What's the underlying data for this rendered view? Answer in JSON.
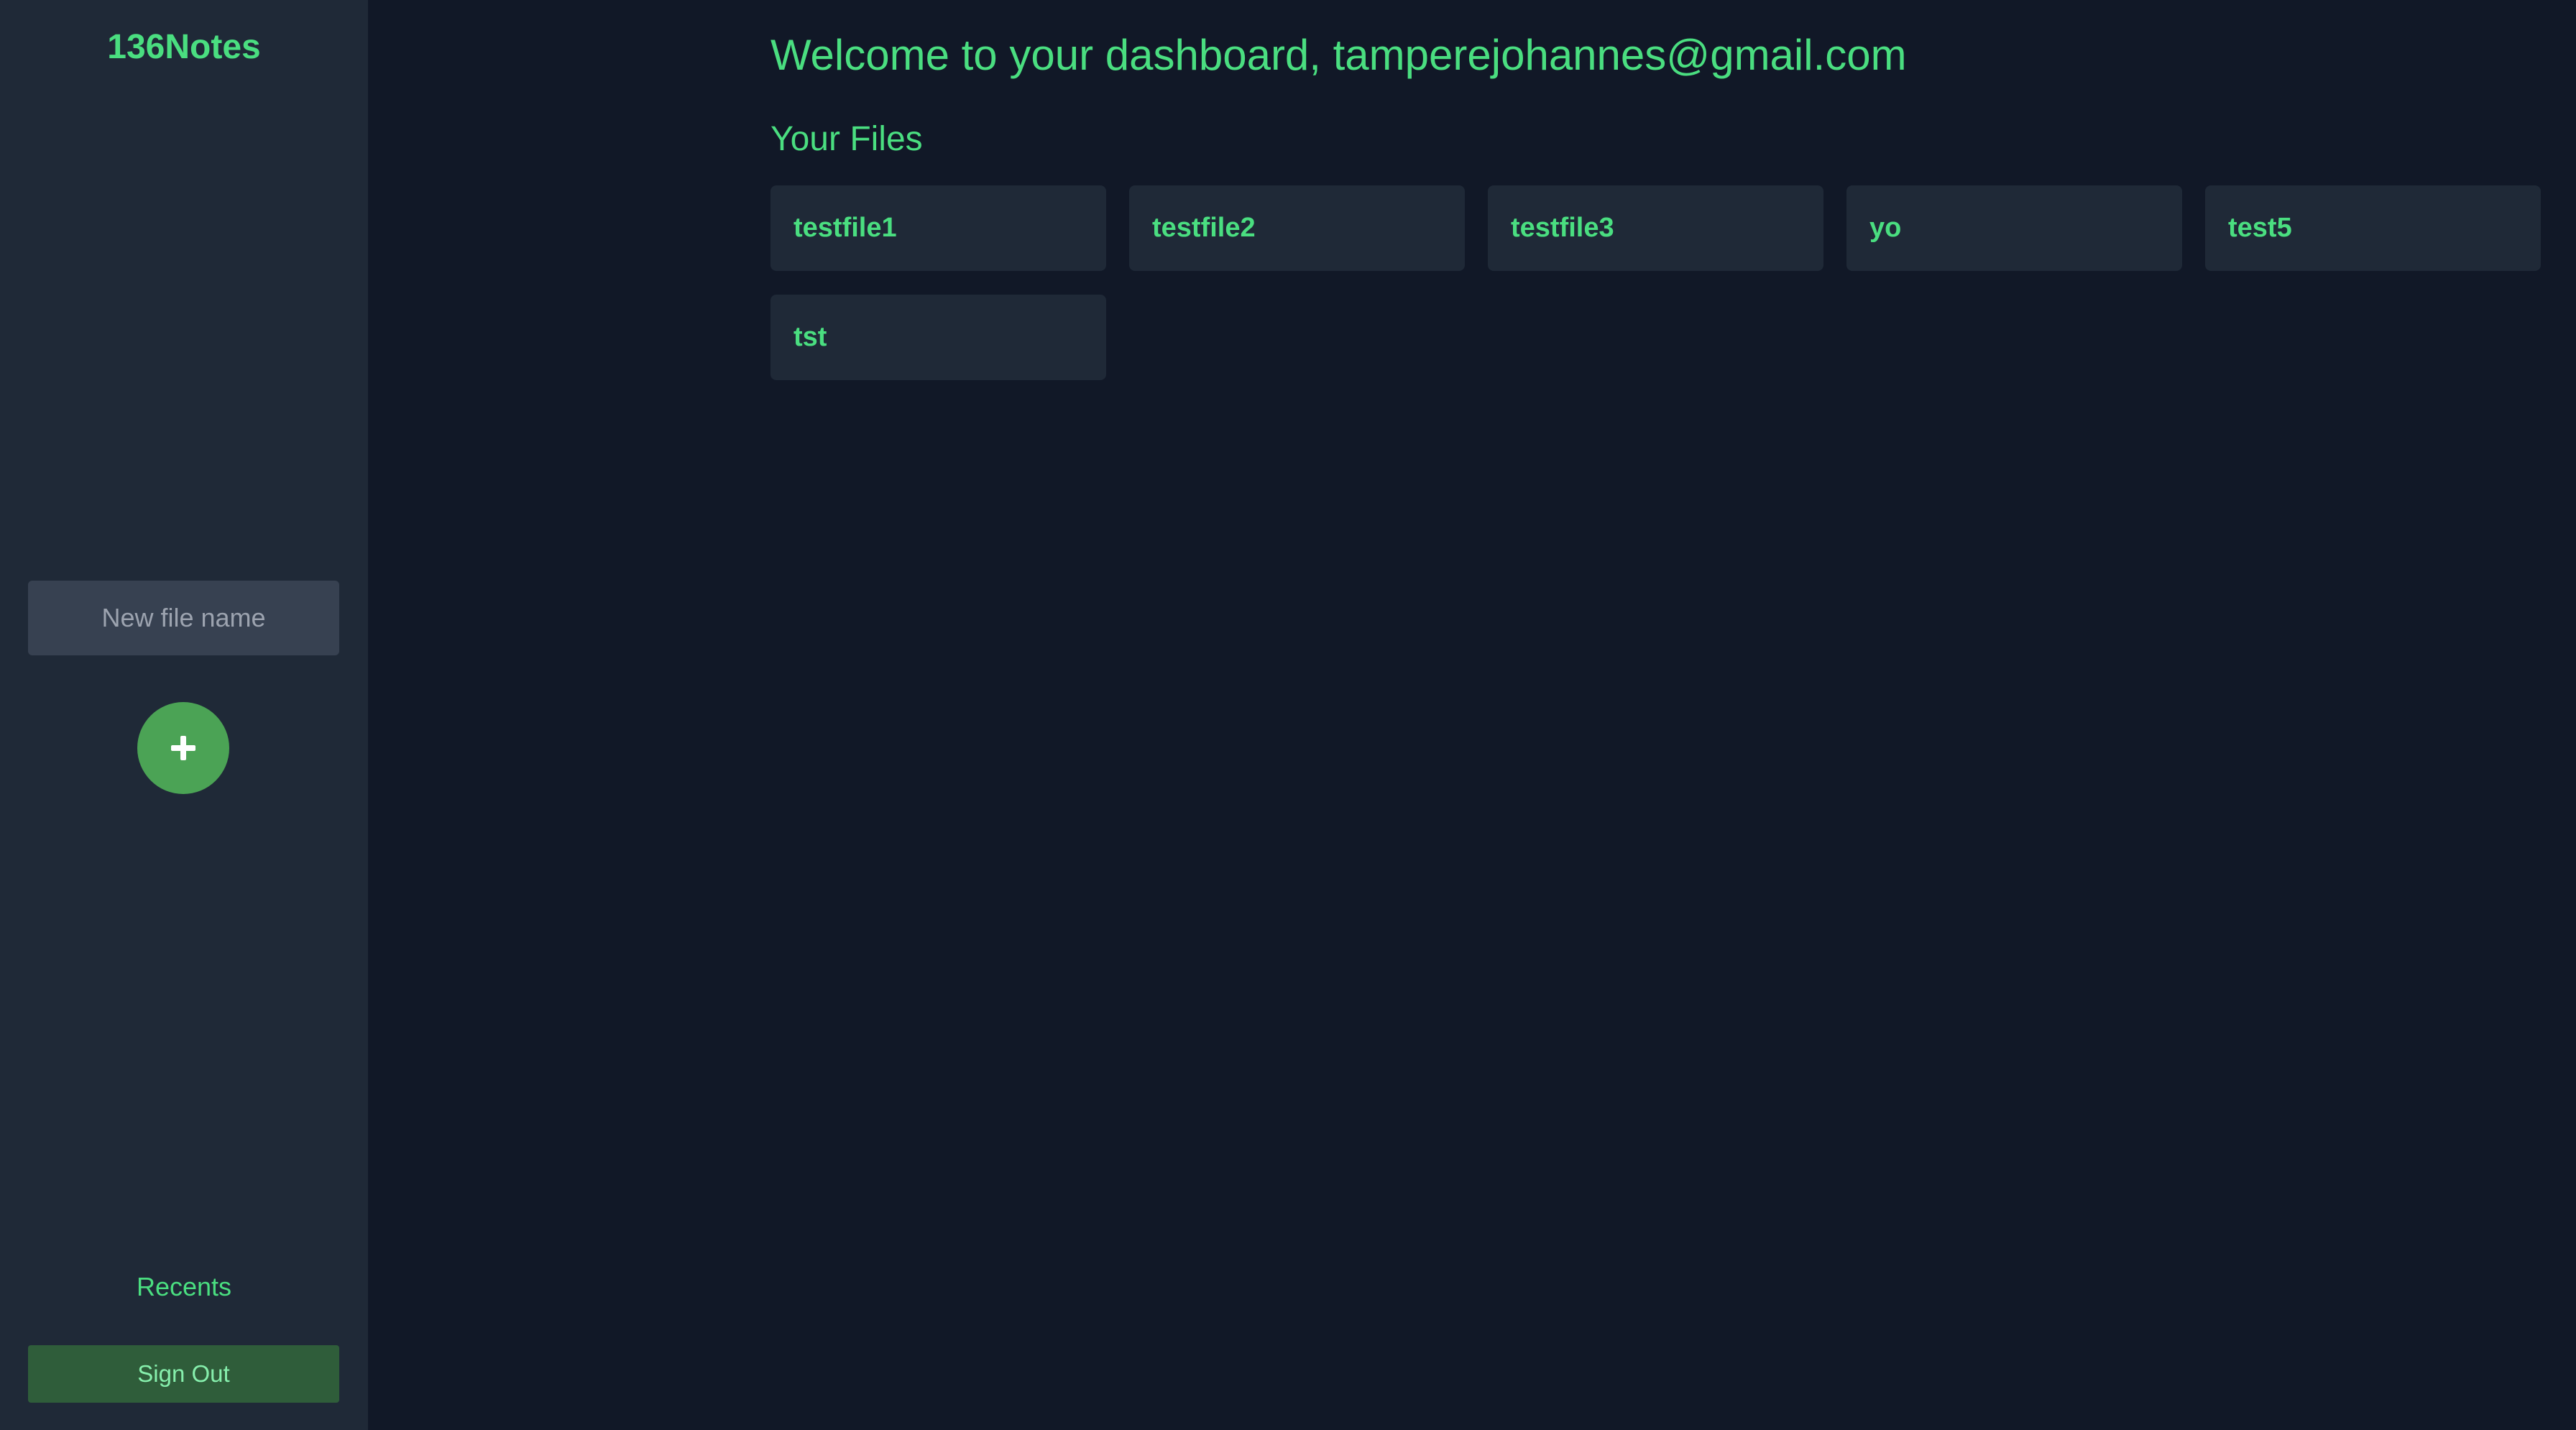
{
  "sidebar": {
    "brand": "136Notes",
    "new_file_placeholder": "New file name",
    "new_file_value": "",
    "add_button_icon": "plus-icon",
    "recents_label": "Recents",
    "signout_label": "Sign Out"
  },
  "main": {
    "welcome_text": "Welcome to your dashboard, tamperejohannes@gmail.com",
    "files_title": "Your Files",
    "files": [
      {
        "name": "testfile1"
      },
      {
        "name": "testfile2"
      },
      {
        "name": "testfile3"
      },
      {
        "name": "yo"
      },
      {
        "name": "test5"
      },
      {
        "name": "tst"
      }
    ]
  },
  "colors": {
    "background": "#111827",
    "sidebar": "#1f2937",
    "accent": "#4ade80",
    "add_button": "#4ba355",
    "signout_button": "#2f5d3a",
    "input": "#374151"
  }
}
